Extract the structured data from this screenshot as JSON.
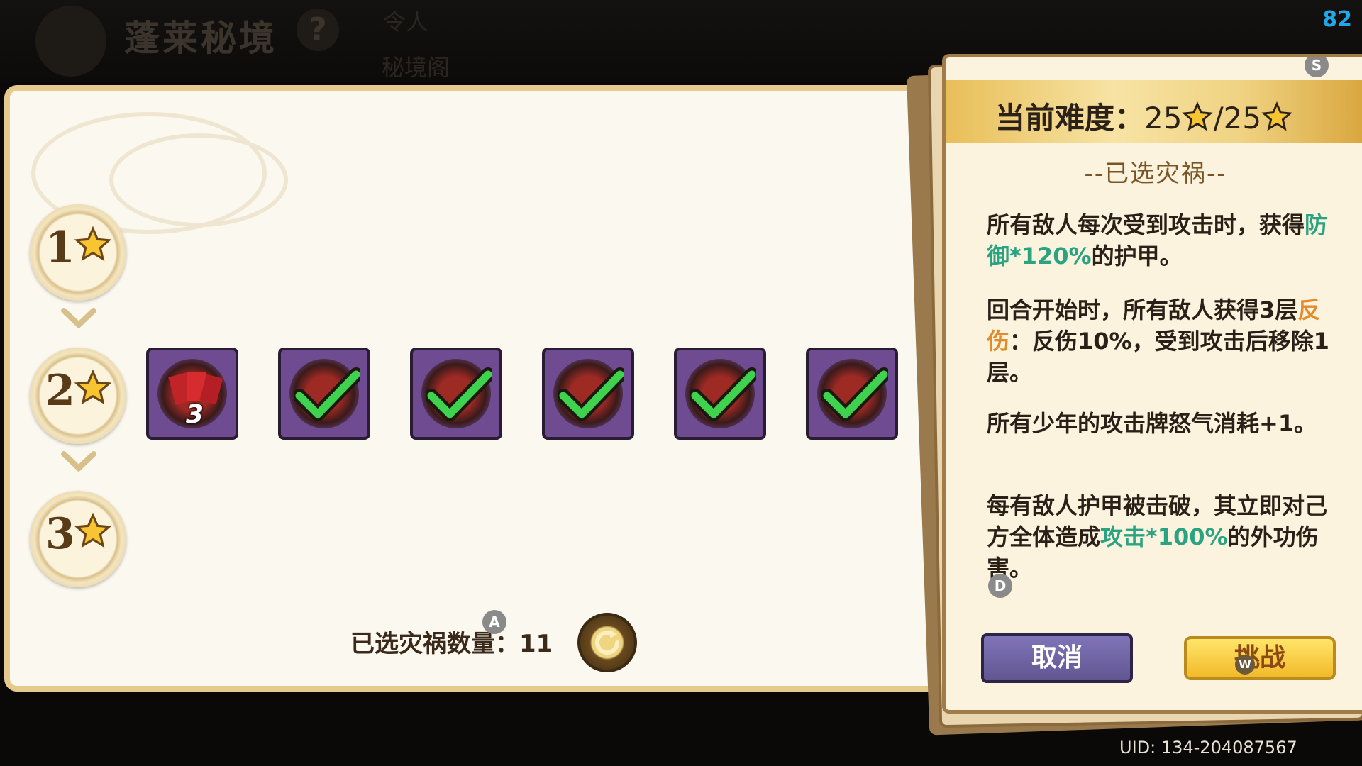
{
  "header": {
    "title": "蓬莱秘境",
    "help_glyph": "?",
    "tab_top": "令人",
    "tab_bottom": "秘境阁",
    "fps": "82"
  },
  "levels": [
    {
      "num": "1",
      "icon": "star-icon"
    },
    {
      "num": "2",
      "icon": "star-icon"
    },
    {
      "num": "3",
      "icon": "star-icon"
    }
  ],
  "curses": {
    "first_badge": "3",
    "items": [
      "red-cards",
      "red-swirl",
      "red-rune",
      "red-flower",
      "red-drum",
      "red-flame"
    ]
  },
  "footer": {
    "count_label": "已选灾祸数量：11",
    "key_a": "A"
  },
  "card": {
    "key_s": "S",
    "difficulty_label": "当前难度：",
    "difficulty_current": "25",
    "difficulty_sep": "/",
    "difficulty_max": "25",
    "selected_title": "--已选灾祸--",
    "desc1_a": "所有敌人每次受到攻击时，获得",
    "desc1_hl": "防御*120%",
    "desc1_b": "的护甲。",
    "desc2_a": "回合开始时，所有敌人获得3层",
    "desc2_hl": "反伤",
    "desc2_b": "：反伤10%，受到攻击后移除1层。",
    "desc3": "所有少年的攻击牌怒气消耗+1。",
    "desc4_a": "每有敌人护甲被击破，其立即对己方全体造成",
    "desc4_hl": "攻击*100%",
    "desc4_b": "的外功伤害。",
    "key_d": "D",
    "cancel_label": "取消",
    "challenge_label": "挑战",
    "key_w": "W"
  },
  "uid": "UID: 134-204087567",
  "colors": {
    "highlight_green": "#2aa382",
    "highlight_orange": "#e28b2a",
    "cancel_button": "#6f63a3",
    "challenge_button": "#f7d04a"
  }
}
